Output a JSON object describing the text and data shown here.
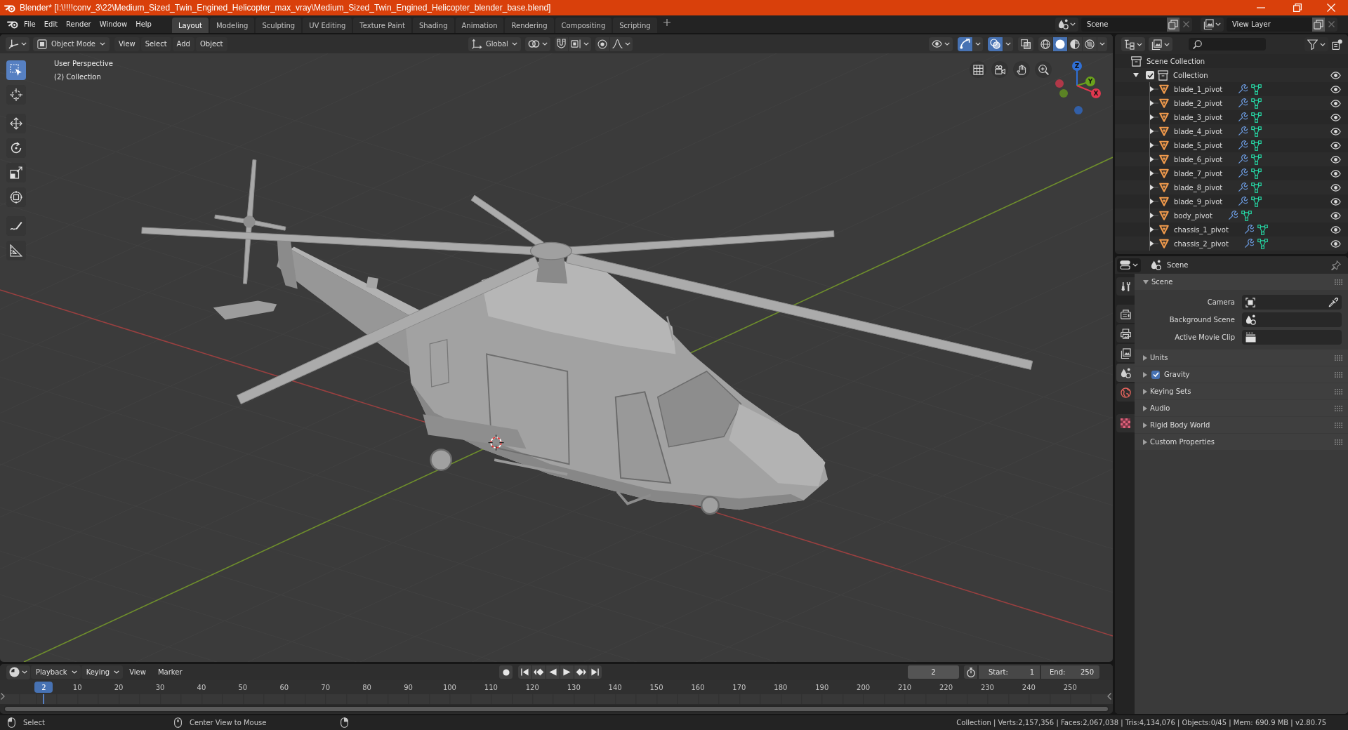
{
  "title_bar": {
    "title": "Blender* [I:\\!!!!conv_3\\22\\Medium_Sized_Twin_Engined_Helicopter_max_vray\\Medium_Sized_Twin_Engined_Helicopter_blender_base.blend]"
  },
  "top_bar": {
    "menus": [
      "File",
      "Edit",
      "Render",
      "Window",
      "Help"
    ],
    "workspaces": [
      {
        "label": "Layout",
        "selected": true
      },
      {
        "label": "Modeling",
        "selected": false
      },
      {
        "label": "Sculpting",
        "selected": false
      },
      {
        "label": "UV Editing",
        "selected": false
      },
      {
        "label": "Texture Paint",
        "selected": false
      },
      {
        "label": "Shading",
        "selected": false
      },
      {
        "label": "Animation",
        "selected": false
      },
      {
        "label": "Rendering",
        "selected": false
      },
      {
        "label": "Compositing",
        "selected": false
      },
      {
        "label": "Scripting",
        "selected": false
      }
    ],
    "scene": "Scene",
    "view_layer": "View Layer"
  },
  "viewport": {
    "mode": "Object Mode",
    "menus": [
      "View",
      "Select",
      "Add",
      "Object"
    ],
    "orientation": "Global",
    "gizmos_on": true,
    "overlays_on": true,
    "xray_on": false,
    "shading": [
      {
        "kind": "wireframe",
        "selected": false
      },
      {
        "kind": "solid",
        "selected": true
      },
      {
        "kind": "material",
        "selected": false
      },
      {
        "kind": "rendered",
        "selected": false
      }
    ],
    "tools": [
      {
        "kind": "select_box",
        "selected": true
      },
      {
        "kind": "cursor",
        "selected": false
      },
      {
        "kind": "move",
        "selected": false
      },
      {
        "kind": "rotate",
        "selected": false
      },
      {
        "kind": "scale",
        "selected": false
      },
      {
        "kind": "transform",
        "selected": false
      },
      {
        "kind": "annotate",
        "selected": false
      },
      {
        "kind": "measure",
        "selected": false
      }
    ],
    "overlay_lines": [
      "User Perspective",
      "(2) Collection"
    ],
    "gizmo_axes": [
      {
        "label": "Z",
        "color": "#2f6fd6"
      },
      {
        "label": "Y",
        "color": "#6aa21c"
      },
      {
        "label": "X",
        "color": "#e2384f"
      }
    ]
  },
  "outliner": {
    "root": "Scene Collection",
    "collections": [
      {
        "name": "Collection",
        "expanded": true,
        "checked": true,
        "visible": true,
        "children": [
          {
            "name": "blade_1_pivot",
            "expanded": false,
            "visible": true
          },
          {
            "name": "blade_2_pivot",
            "expanded": false,
            "visible": true
          },
          {
            "name": "blade_3_pivot",
            "expanded": false,
            "visible": true
          },
          {
            "name": "blade_4_pivot",
            "expanded": false,
            "visible": true
          },
          {
            "name": "blade_5_pivot",
            "expanded": false,
            "visible": true
          },
          {
            "name": "blade_6_pivot",
            "expanded": false,
            "visible": true
          },
          {
            "name": "blade_7_pivot",
            "expanded": false,
            "visible": true
          },
          {
            "name": "blade_8_pivot",
            "expanded": false,
            "visible": true
          },
          {
            "name": "blade_9_pivot",
            "expanded": false,
            "visible": true
          },
          {
            "name": "body_pivot",
            "expanded": false,
            "visible": true
          },
          {
            "name": "chassis_1_pivot",
            "expanded": false,
            "visible": true
          },
          {
            "name": "chassis_2_pivot",
            "expanded": false,
            "visible": true
          }
        ]
      }
    ]
  },
  "properties": {
    "title": "Scene",
    "tabs": [
      {
        "kind": "tool",
        "selected": false
      },
      {
        "kind": "render",
        "selected": false
      },
      {
        "kind": "output",
        "selected": false
      },
      {
        "kind": "view_layer",
        "selected": false
      },
      {
        "kind": "scene",
        "selected": true
      },
      {
        "kind": "world",
        "selected": false
      },
      {
        "kind": "texture",
        "selected": false
      }
    ],
    "panels": [
      {
        "title": "Scene",
        "kind": "plain",
        "expanded": true,
        "fields": [
          {
            "label": "Camera",
            "kind": "camera"
          },
          {
            "label": "Background Scene",
            "kind": "scene"
          },
          {
            "label": "Active Movie Clip",
            "kind": "clip"
          }
        ]
      },
      {
        "title": "Units",
        "kind": "plain",
        "expanded": false
      },
      {
        "title": "Gravity",
        "kind": "toggle",
        "checked": true,
        "expanded": false
      },
      {
        "title": "Keying Sets",
        "kind": "plain",
        "expanded": false
      },
      {
        "title": "Audio",
        "kind": "plain",
        "expanded": false
      },
      {
        "title": "Rigid Body World",
        "kind": "plain",
        "expanded": false
      },
      {
        "title": "Custom Properties",
        "kind": "plain",
        "expanded": false
      }
    ]
  },
  "timeline": {
    "menus": [
      {
        "label": "Playback",
        "kind": "dropdown"
      },
      {
        "label": "Keying",
        "kind": "dropdown"
      },
      {
        "label": "View",
        "kind": "menu"
      },
      {
        "label": "Marker",
        "kind": "menu"
      }
    ],
    "current_frame": "2",
    "start": {
      "label": "Start:",
      "value": "1"
    },
    "end": {
      "label": "End:",
      "value": "250"
    },
    "playhead": {
      "label": "2",
      "level": 0.0394
    },
    "ruler": [
      "10",
      "20",
      "30",
      "40",
      "50",
      "60",
      "70",
      "80",
      "90",
      "100",
      "110",
      "120",
      "130",
      "140",
      "150",
      "160",
      "170",
      "180",
      "190",
      "200",
      "210",
      "220",
      "230",
      "240",
      "250"
    ]
  },
  "status_bar": {
    "hints": [
      {
        "kind": "left_mouse",
        "label": "Select"
      },
      {
        "kind": "middle_mouse",
        "label": "Center View to Mouse"
      },
      {
        "kind": "right_mouse"
      }
    ],
    "stats": "Collection | Verts:2,157,356 | Faces:2,067,038 | Tris:4,134,076 | Objects:0/45 | Mem: 690.9 MB | v2.80.75"
  }
}
